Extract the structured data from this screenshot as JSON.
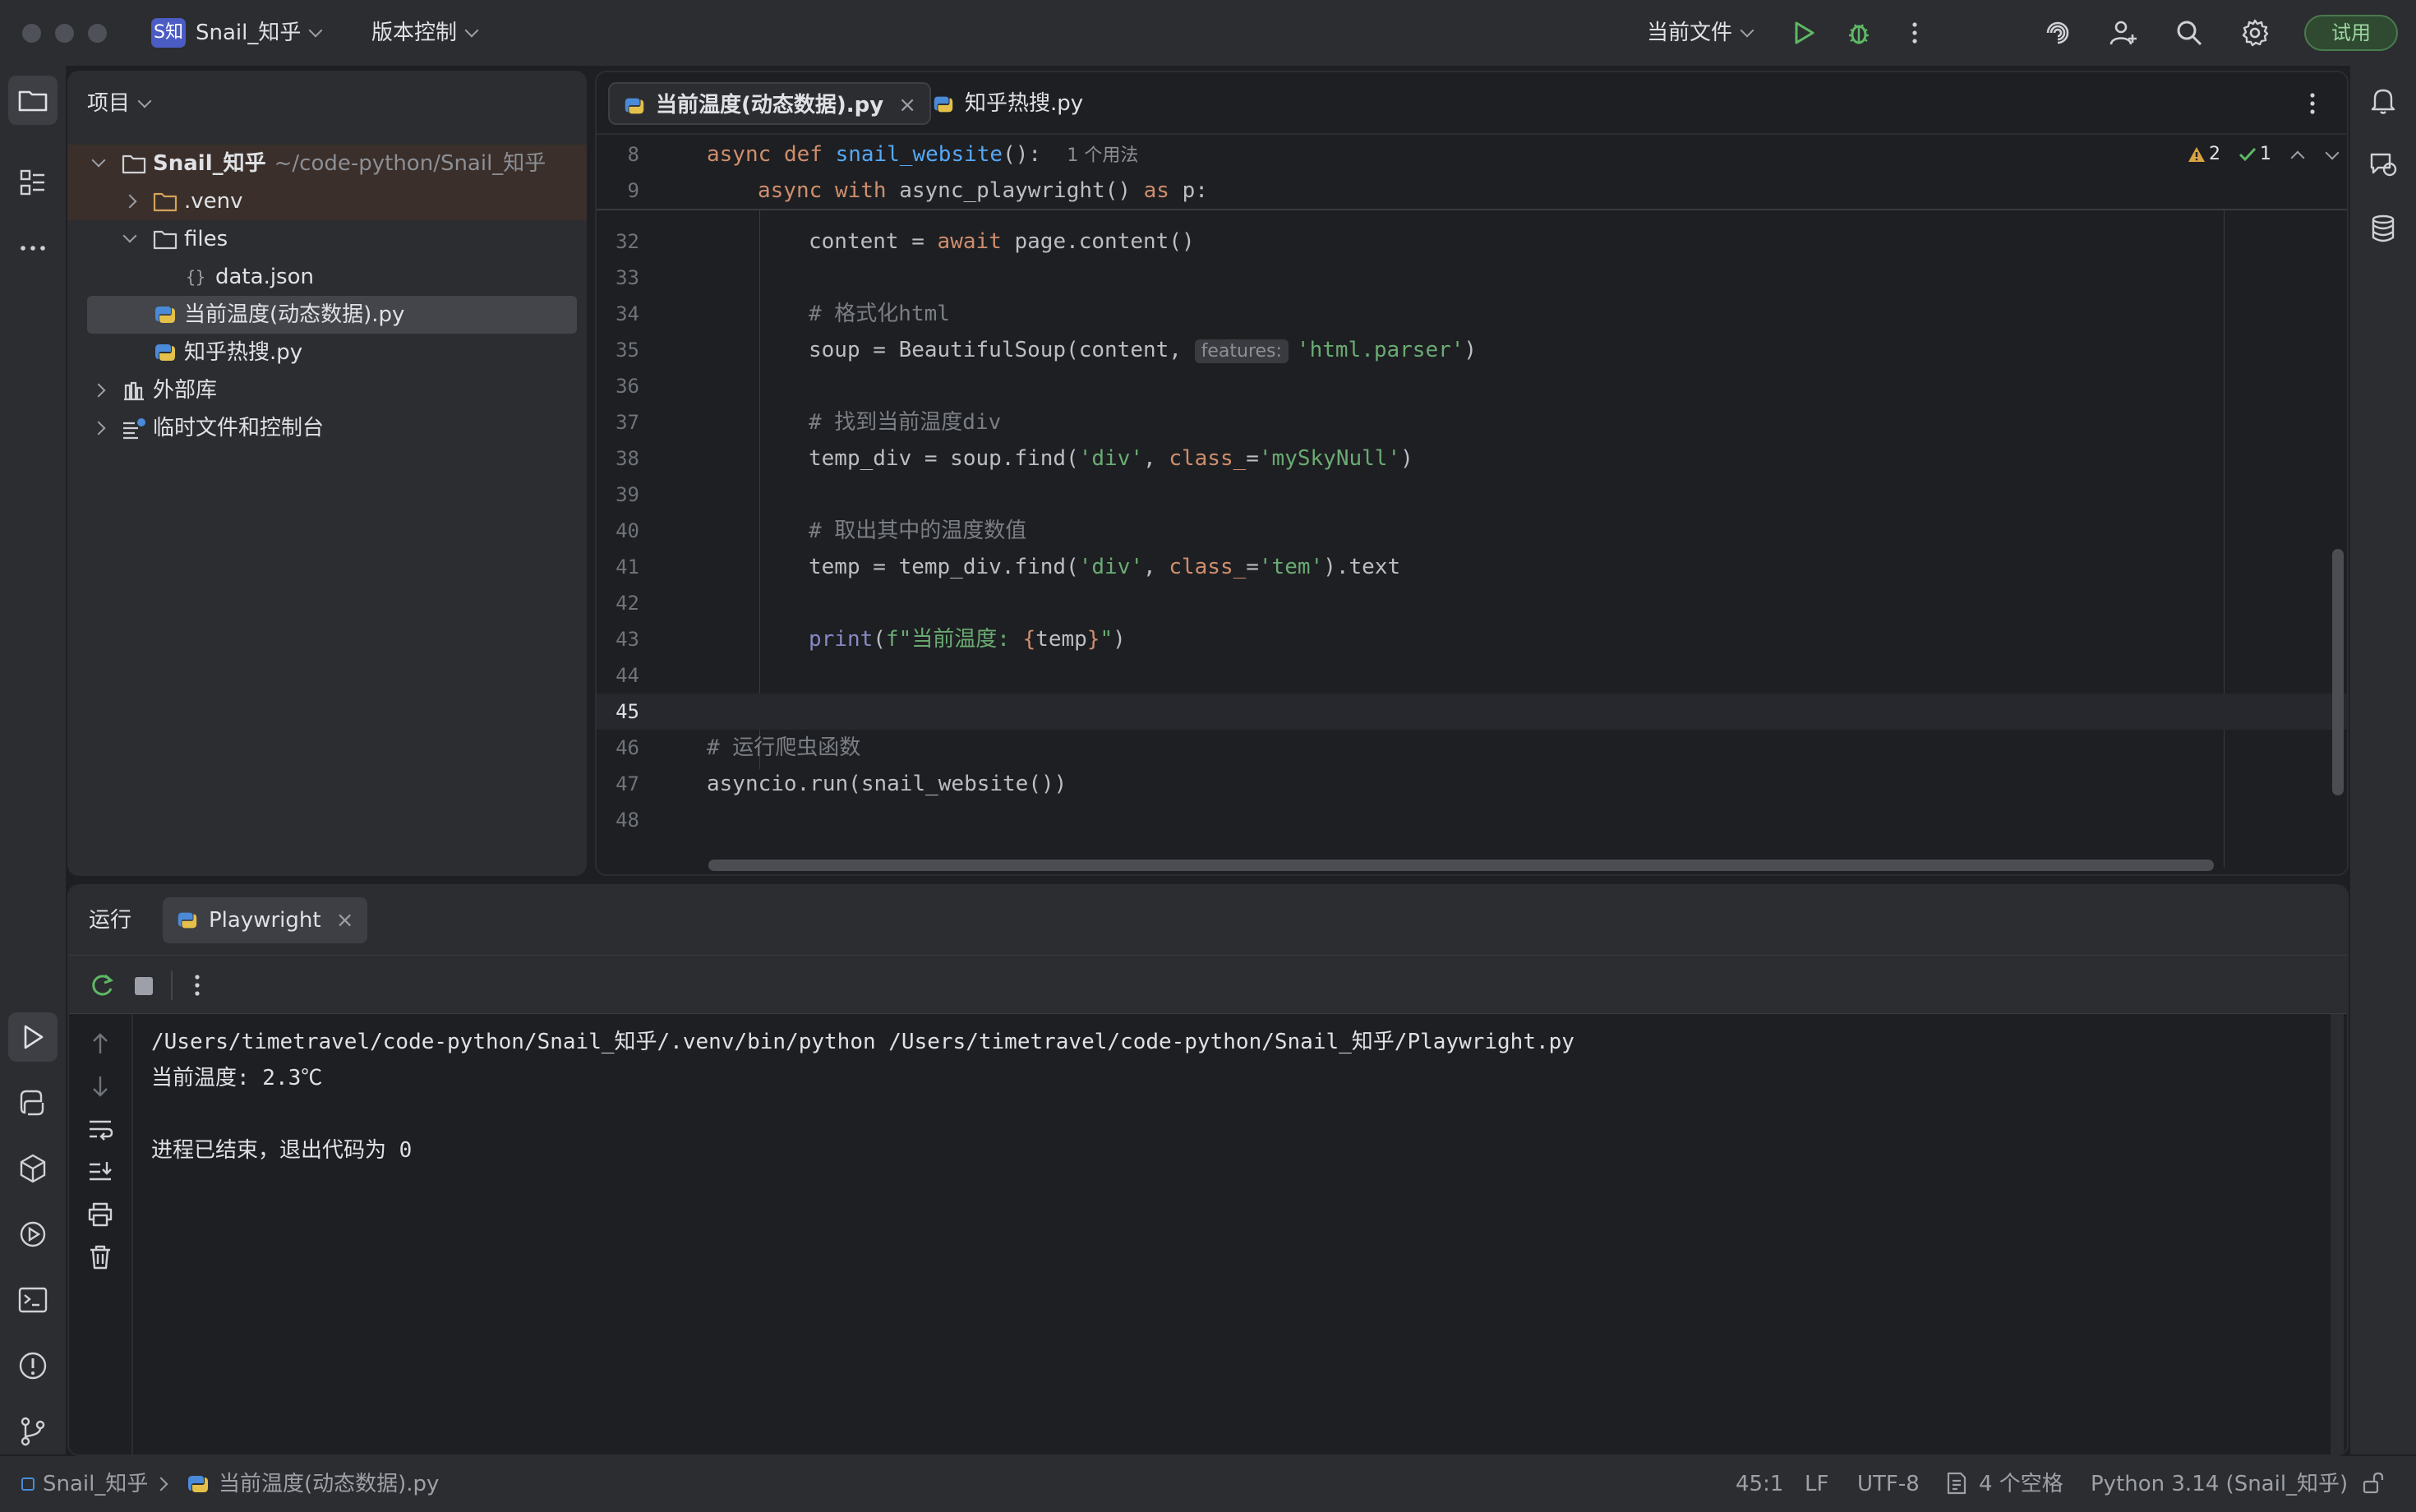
{
  "titlebar": {
    "project_badge": "S知",
    "project_name": "Snail_知乎",
    "vcs_label": "版本控制",
    "run_config": "当前文件",
    "trial_label": "试用"
  },
  "project_panel": {
    "title": "项目",
    "tree": [
      {
        "label": "Snail_知乎",
        "path": "~/code-python/Snail_知乎",
        "icon": "folder-icon"
      },
      {
        "label": ".venv",
        "icon": "folder-icon"
      },
      {
        "label": "files",
        "icon": "folder-icon"
      },
      {
        "label": "data.json",
        "icon": "json-file-icon"
      },
      {
        "label": "当前温度(动态数据).py",
        "icon": "python-file-icon"
      },
      {
        "label": "知乎热搜.py",
        "icon": "python-file-icon"
      },
      {
        "label": "外部库",
        "icon": "library-icon"
      },
      {
        "label": "临时文件和控制台",
        "icon": "scratch-icon"
      }
    ]
  },
  "editor": {
    "tabs": [
      {
        "label": "当前温度(动态数据).py",
        "close": "×"
      },
      {
        "label": "知乎热搜.py"
      }
    ],
    "sticky": {
      "line8_num": "8",
      "line8_kw1": "async",
      "line8_kw2": "def",
      "line8_fn": "snail_website",
      "line8_rest": "():",
      "line8_usage": "1 个用法",
      "line9_num": "9",
      "line9_kw1": "async",
      "line9_kw2": "with",
      "line9_mid": "async_playwright()",
      "line9_kw3": "as",
      "line9_rest": "p:"
    },
    "inspections": {
      "warnings": "2",
      "ok": "1"
    },
    "line_numbers": [
      "32",
      "33",
      "34",
      "35",
      "36",
      "37",
      "38",
      "39",
      "40",
      "41",
      "42",
      "43",
      "44",
      "45",
      "46",
      "47",
      "48"
    ],
    "code": {
      "l32a": "content = ",
      "l32kw": "await",
      "l32b": " page.content()",
      "l34": "# 格式化html",
      "l35a": "soup = BeautifulSoup(content, ",
      "l35hint": "features:",
      "l35str": "'html.parser'",
      "l35b": ")",
      "l37": "# 找到当前温度div",
      "l38a": "temp_div = soup.find(",
      "l38s1": "'div'",
      "l38b": ", ",
      "l38p": "class_",
      "l38c": "=",
      "l38s2": "'mySkyNull'",
      "l38d": ")",
      "l40": "# 取出其中的温度数值",
      "l41a": "temp = temp_div.find(",
      "l41s1": "'div'",
      "l41b": ", ",
      "l41p": "class_",
      "l41c": "=",
      "l41s2": "'tem'",
      "l41d": ").text",
      "l43bi": "print",
      "l43a": "(",
      "l43s1": "f\"当前温度: ",
      "l43br1": "{",
      "l43v": "temp",
      "l43br2": "}",
      "l43s2": "\"",
      "l43b": ")",
      "l46": "# 运行爬虫函数",
      "l47": "asyncio.run(snail_website())"
    }
  },
  "run_panel": {
    "title": "运行",
    "tab_label": "Playwright",
    "tab_close": "×",
    "output": [
      "/Users/timetravel/code-python/Snail_知乎/.venv/bin/python /Users/timetravel/code-python/Snail_知乎/Playwright.py",
      "当前温度: 2.3℃",
      "",
      "进程已结束，退出代码为 0"
    ]
  },
  "statusbar": {
    "breadcrumb_project": "Snail_知乎",
    "breadcrumb_file": "当前温度(动态数据).py",
    "position": "45:1",
    "line_ending": "LF",
    "encoding": "UTF-8",
    "indent": "4 个空格",
    "interpreter": "Python 3.14 (Snail_知乎)"
  }
}
